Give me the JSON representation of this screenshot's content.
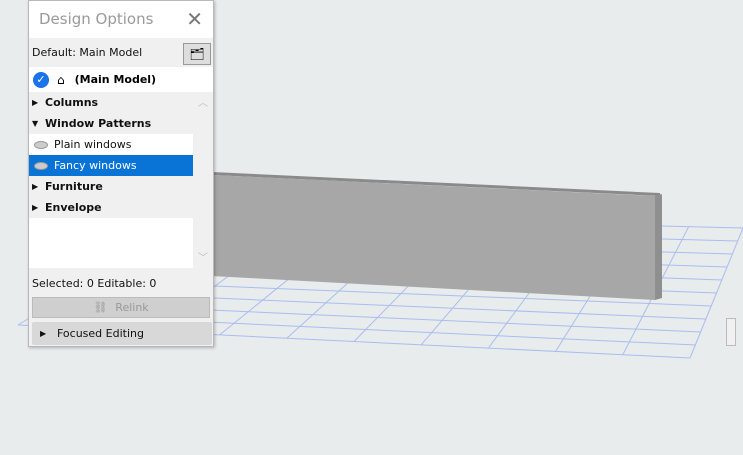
{
  "panel": {
    "title": "Design Options",
    "default_label": "Default: Main Model",
    "main_model": "(Main Model)",
    "items": [
      {
        "label": "Columns",
        "type": "group",
        "expanded": false
      },
      {
        "label": "Window Patterns",
        "type": "group",
        "expanded": true
      },
      {
        "label": "Plain windows",
        "type": "option",
        "selected": false
      },
      {
        "label": "Fancy windows",
        "type": "option",
        "selected": true
      },
      {
        "label": "Furniture",
        "type": "group",
        "expanded": false
      },
      {
        "label": "Envelope",
        "type": "group",
        "expanded": false
      }
    ],
    "status": "Selected: 0 Editable: 0",
    "relink_label": "Relink",
    "focused_label": "Focused Editing"
  },
  "colors": {
    "accent": "#0a74d6",
    "grid": "#9bb3f0",
    "wall": "#a8a8a8"
  }
}
